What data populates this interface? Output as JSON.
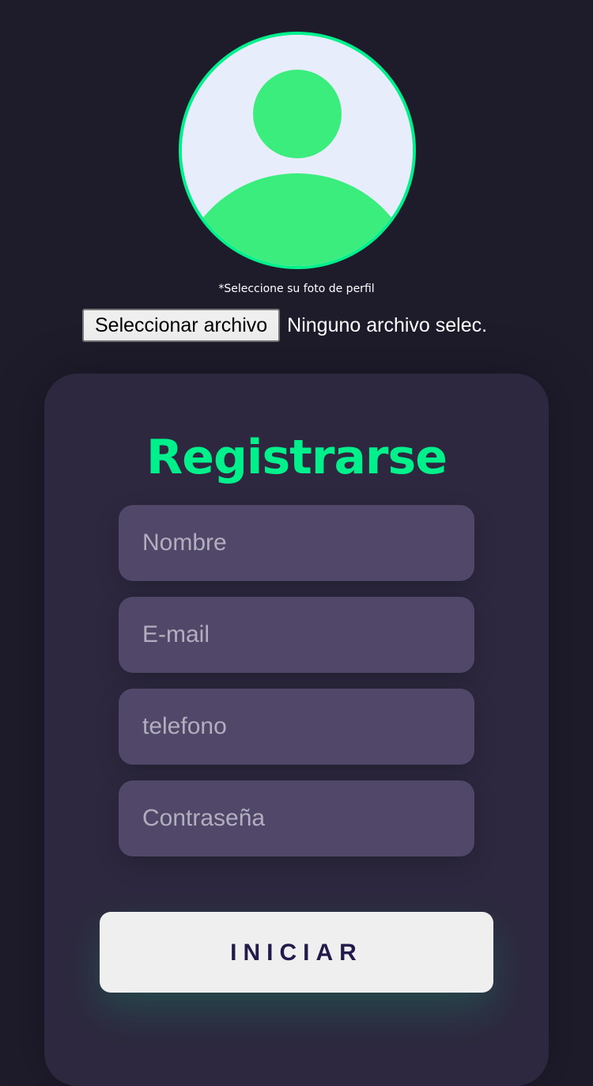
{
  "profile": {
    "avatar_icon": "user-silhouette-icon",
    "hint": "*Seleccione su foto de perfil",
    "file_button_label": "Seleccionar archivo",
    "file_status": "Ninguno archivo selec."
  },
  "form": {
    "title": "Registrarse",
    "fields": [
      {
        "placeholder": "Nombre",
        "value": ""
      },
      {
        "placeholder": "E-mail",
        "value": ""
      },
      {
        "placeholder": "telefono",
        "value": ""
      },
      {
        "placeholder": "Contraseña",
        "value": ""
      }
    ],
    "submit_label": "INICIAR"
  },
  "colors": {
    "background": "#1e1b2b",
    "card": "#2d283f",
    "accent": "#00f08c",
    "field": "#514869",
    "button": "#efefef",
    "button_text": "#201b4b"
  }
}
